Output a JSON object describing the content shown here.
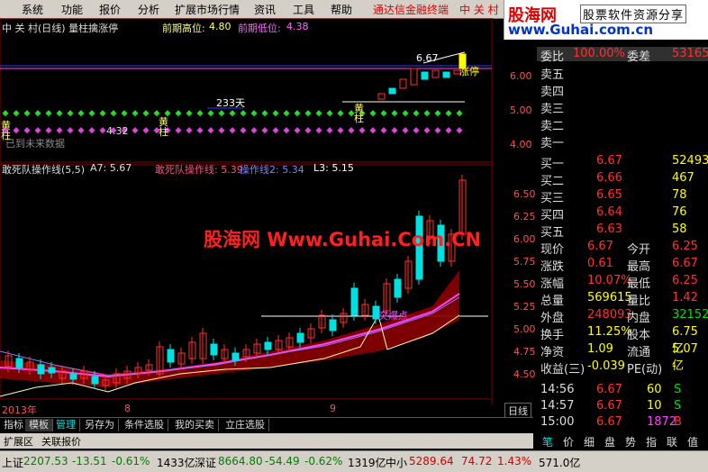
{
  "menu": {
    "items": [
      "系统",
      "功能",
      "报价",
      "分析",
      "扩展市场行情",
      "资讯",
      "工具",
      "帮助"
    ],
    "brand": "通达信金融终端",
    "stock": "中 关 村"
  },
  "logo": {
    "name": "股海网",
    "tagline": "股票软件资源分享",
    "url": "www.Guhai.com.cn"
  },
  "watermark": "股海网 Www.Guhai.Com.CN",
  "chart": {
    "title": "中 关 村(日线) 量柱擒涨停",
    "prev_high_label": "前期高位:",
    "prev_high": "4.80",
    "prev_low_label": "前期低位:",
    "prev_low": "4.38",
    "top_price": "6.67",
    "limit_up": "涨停",
    "days_label": "233天",
    "low_price": "4.32",
    "future_note": "已到未来数据",
    "yellow_bar1": "黄柱",
    "yellow_bar2": "黄柱",
    "yellow_bar3": "黄柱",
    "upper_axis": [
      "6.00",
      "5.00",
      "4.00"
    ],
    "ind_title": "敢死队操作线(5,5)",
    "a7": "A7: 5.67",
    "line1": "敢死队操作线: 5.39",
    "line2": "操作线2: 5.34",
    "l3": "L3: 5.15",
    "ind_axis": [
      "6.50",
      "6.25",
      "6.00",
      "5.75",
      "5.50",
      "5.25",
      "5.00",
      "4.75",
      "4.50"
    ],
    "breakout": "突爆点",
    "time_labels": [
      "2013年",
      "8",
      "9"
    ],
    "period": "日线"
  },
  "quote": {
    "header_left": "委比",
    "header_mid": "100.00%",
    "header_right": "委差",
    "header_val": "53165",
    "sells": [
      {
        "label": "卖五",
        "price": "",
        "vol": ""
      },
      {
        "label": "卖四",
        "price": "",
        "vol": ""
      },
      {
        "label": "卖三",
        "price": "",
        "vol": ""
      },
      {
        "label": "卖二",
        "price": "",
        "vol": ""
      },
      {
        "label": "卖一",
        "price": "",
        "vol": ""
      }
    ],
    "buys": [
      {
        "label": "买一",
        "price": "6.67",
        "vol": "52493"
      },
      {
        "label": "买二",
        "price": "6.66",
        "vol": "467"
      },
      {
        "label": "买三",
        "price": "6.65",
        "vol": "78"
      },
      {
        "label": "买四",
        "price": "6.64",
        "vol": "76"
      },
      {
        "label": "买五",
        "price": "6.63",
        "vol": "58"
      }
    ],
    "stats": [
      {
        "l1": "现价",
        "v1": "6.67",
        "l2": "今开",
        "v2": "6.25"
      },
      {
        "l1": "涨跌",
        "v1": "0.61",
        "l2": "最高",
        "v2": "6.67"
      },
      {
        "l1": "涨幅",
        "v1": "10.07%",
        "l2": "最低",
        "v2": "6.25"
      },
      {
        "l1": "总量",
        "v1": "569615",
        "l2": "量比",
        "v2": "1.42"
      },
      {
        "l1": "外盘",
        "v1": "248093",
        "l2": "内盘",
        "v2": "321522"
      },
      {
        "l1": "换手",
        "v1": "11.25%",
        "l2": "股本",
        "v2": "6.75亿"
      },
      {
        "l1": "净资",
        "v1": "1.09",
        "l2": "流通",
        "v2": "5.07亿"
      },
      {
        "l1": "收益(三)",
        "v1": "-0.039",
        "l2": "PE(动)",
        "v2": "-"
      }
    ],
    "ticks": [
      {
        "time": "14:56",
        "price": "6.67",
        "vol": "60",
        "flag": "S"
      },
      {
        "time": "14:57",
        "price": "6.67",
        "vol": "10",
        "flag": "S"
      },
      {
        "time": "15:00",
        "price": "6.67",
        "vol": "1872",
        "flag": "B"
      }
    ]
  },
  "tabs": [
    "指标",
    "模板",
    "管理",
    "另存为",
    "条件选股",
    "我的买卖",
    "立庄选股"
  ],
  "subtabs": [
    "扩展区",
    "关联报价"
  ],
  "right_tabs": [
    "笔",
    "价",
    "细",
    "盘",
    "势",
    "指",
    "联",
    "值"
  ],
  "status": {
    "sh_label": "上证",
    "sh_val": "2207.53",
    "sh_chg": "-13.51",
    "sh_pct": "-0.61%",
    "sh_amt": "1433亿",
    "sz_label": "深证",
    "sz_val": "8664.80",
    "sz_chg": "-54.49",
    "sz_pct": "-0.62%",
    "sz_amt": "1319亿",
    "zx_label": "中小",
    "zx_val": "5289.64",
    "zx_chg": "74.72",
    "zx_pct": "1.43%",
    "zx_amt": "571.0亿"
  },
  "colors": {
    "up": "#ff3030",
    "down": "#00e000",
    "price": "#ffff00",
    "ma_pink": "#ff40ff",
    "band": "#8b0000"
  }
}
